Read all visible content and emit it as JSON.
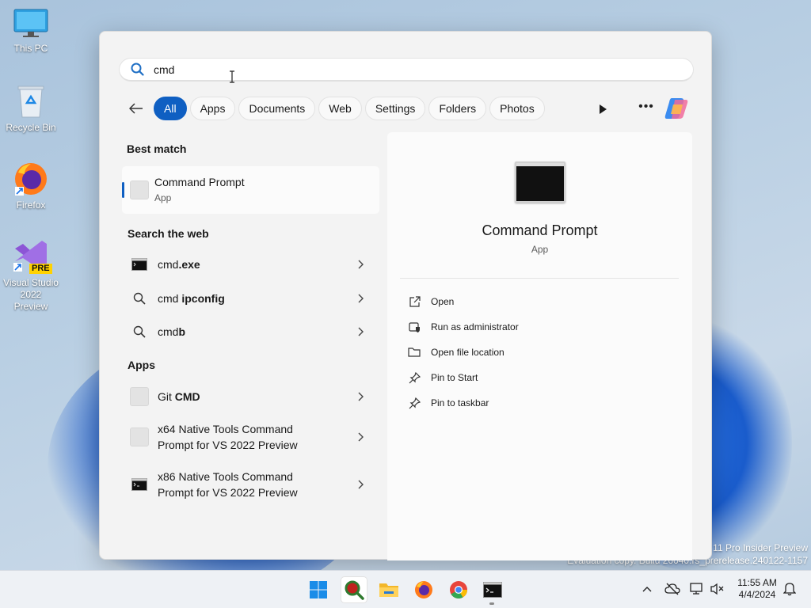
{
  "desktop": {
    "icons": [
      {
        "label": "This PC"
      },
      {
        "label": "Recycle Bin"
      },
      {
        "label": "Firefox"
      },
      {
        "label": "Visual Studio 2022 Preview",
        "badge": "PRE"
      }
    ],
    "watermark_line1": "11 Pro Insider Preview",
    "watermark_line2": "Evaluation copy. Build 26040.rs_prerelease.240122-1157"
  },
  "search": {
    "query": "cmd",
    "icon": "search-icon"
  },
  "filters": {
    "items": [
      "All",
      "Apps",
      "Documents",
      "Web",
      "Settings",
      "Folders",
      "Photos"
    ],
    "active": "All"
  },
  "results": {
    "best_match_heading": "Best match",
    "best_match": {
      "title": "Command Prompt",
      "subtitle": "App"
    },
    "web_heading": "Search the web",
    "web": [
      {
        "prefix": "cmd",
        "suffix": ".exe"
      },
      {
        "prefix": "cmd ",
        "suffix": "ipconfig"
      },
      {
        "prefix": "cmd",
        "suffix": "b"
      }
    ],
    "apps_heading": "Apps",
    "apps": [
      {
        "prefix": "Git ",
        "suffix": "CMD",
        "line2": ""
      },
      {
        "prefix": "x64 Native Tools Command",
        "suffix": "",
        "line2": "Prompt for VS 2022 Preview"
      },
      {
        "prefix": "x86 Native Tools Command",
        "suffix": "",
        "line2": "Prompt for VS 2022 Preview"
      }
    ]
  },
  "preview": {
    "title": "Command Prompt",
    "subtitle": "App",
    "actions": [
      "Open",
      "Run as administrator",
      "Open file location",
      "Pin to Start",
      "Pin to taskbar"
    ]
  },
  "taskbar": {
    "time": "11:55 AM",
    "date": "4/4/2024"
  },
  "colors": {
    "accent": "#0f5fc2",
    "panel": "#f3f3f3"
  }
}
